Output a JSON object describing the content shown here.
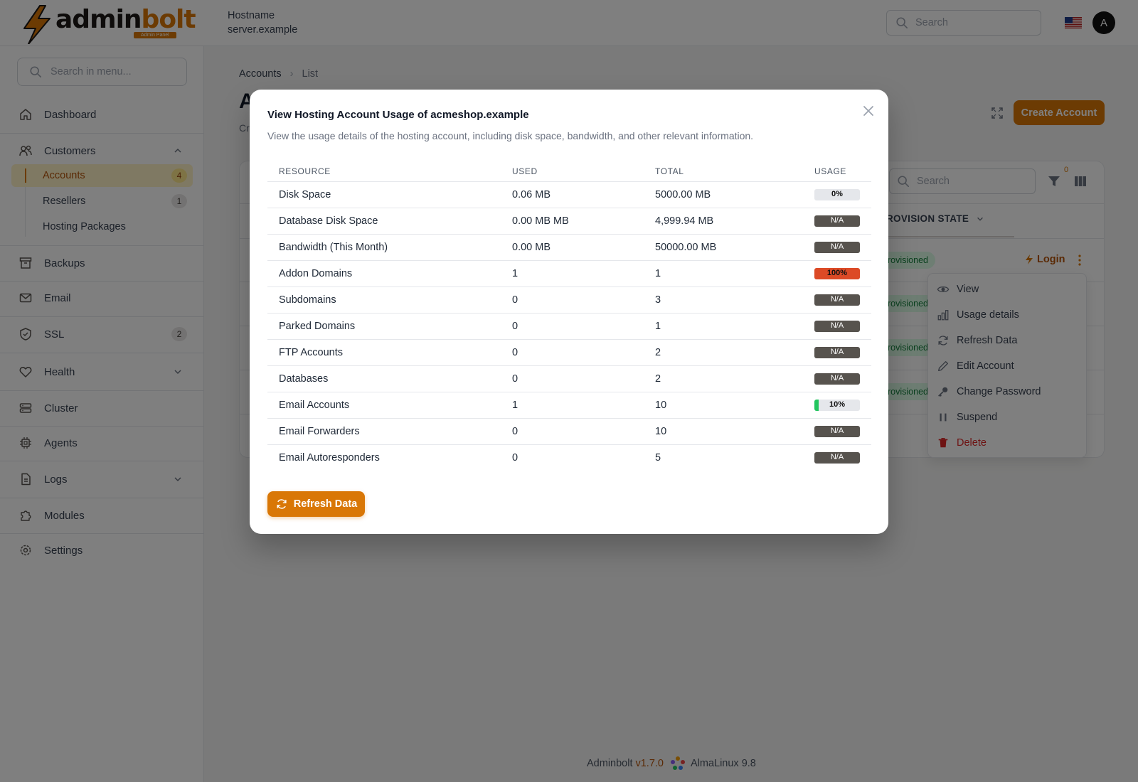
{
  "header": {
    "logo_text_a": "admin",
    "logo_text_b": "bolt",
    "logo_badge": "Admin Panel",
    "hostname_label": "Hostname",
    "hostname_value": "server.example",
    "search_placeholder": "Search",
    "avatar_initial": "A",
    "flag": "us-flag-icon"
  },
  "sidebar": {
    "search_placeholder": "Search in menu...",
    "items": {
      "dashboard": "Dashboard",
      "customers": "Customers",
      "backups": "Backups",
      "email": "Email",
      "ssl": "SSL",
      "ssl_count": "2",
      "health": "Health",
      "cluster": "Cluster",
      "agents": "Agents",
      "logs": "Logs",
      "modules": "Modules",
      "settings": "Settings"
    },
    "customers_sub": {
      "accounts": "Accounts",
      "accounts_count": "4",
      "resellers": "Resellers",
      "resellers_count": "1",
      "hosting_packages": "Hosting Packages"
    }
  },
  "main": {
    "breadcrumb": [
      "Accounts",
      "List"
    ],
    "title": "A",
    "subtitle": "Cr",
    "create_button": "Create Account",
    "table_search_placeholder": "Search",
    "filter_count": "0",
    "column_header": "ROVISION STATE",
    "row_badges": [
      "rovisioned",
      "rovisioned",
      "rovisioned",
      "rovisioned"
    ],
    "login_label": "Login",
    "row_menu": {
      "view": "View",
      "usage": "Usage details",
      "refresh": "Refresh Data",
      "edit": "Edit Account",
      "password": "Change Password",
      "suspend": "Suspend",
      "delete": "Delete"
    }
  },
  "footer": {
    "brand": "Adminbolt",
    "version": "v1.7.0",
    "os": "AlmaLinux 9.8"
  },
  "modal": {
    "title": "View Hosting Account Usage of acmeshop.example",
    "description": "View the usage details of the hosting account, including disk space, bandwidth, and other relevant information.",
    "columns": [
      "RESOURCE",
      "USED",
      "TOTAL",
      "USAGE"
    ],
    "rows": [
      {
        "resource": "Disk Space",
        "used": "0.06 MB",
        "total": "5000.00 MB",
        "usage": "0%",
        "percent": 0,
        "color": "#e5e7eb"
      },
      {
        "resource": "Database Disk Space",
        "used": "0.00 MB MB",
        "total": "4,999.94 MB",
        "usage": "N/A",
        "percent": null,
        "color": ""
      },
      {
        "resource": "Bandwidth (This Month)",
        "used": "0.00 MB",
        "total": "50000.00 MB",
        "usage": "N/A",
        "percent": null,
        "color": ""
      },
      {
        "resource": "Addon Domains",
        "used": "1",
        "total": "1",
        "usage": "100%",
        "percent": 100,
        "color": "#dc4a26"
      },
      {
        "resource": "Subdomains",
        "used": "0",
        "total": "3",
        "usage": "N/A",
        "percent": null,
        "color": ""
      },
      {
        "resource": "Parked Domains",
        "used": "0",
        "total": "1",
        "usage": "N/A",
        "percent": null,
        "color": ""
      },
      {
        "resource": "FTP Accounts",
        "used": "0",
        "total": "2",
        "usage": "N/A",
        "percent": null,
        "color": ""
      },
      {
        "resource": "Databases",
        "used": "0",
        "total": "2",
        "usage": "N/A",
        "percent": null,
        "color": ""
      },
      {
        "resource": "Email Accounts",
        "used": "1",
        "total": "10",
        "usage": "10%",
        "percent": 10,
        "color": "#22c55e"
      },
      {
        "resource": "Email Forwarders",
        "used": "0",
        "total": "10",
        "usage": "N/A",
        "percent": null,
        "color": ""
      },
      {
        "resource": "Email Autoresponders",
        "used": "0",
        "total": "5",
        "usage": "N/A",
        "percent": null,
        "color": ""
      }
    ],
    "refresh_button": "Refresh Data"
  },
  "colors": {
    "accent": "#d97706",
    "danger": "#dc2626",
    "success": "#22c55e"
  }
}
